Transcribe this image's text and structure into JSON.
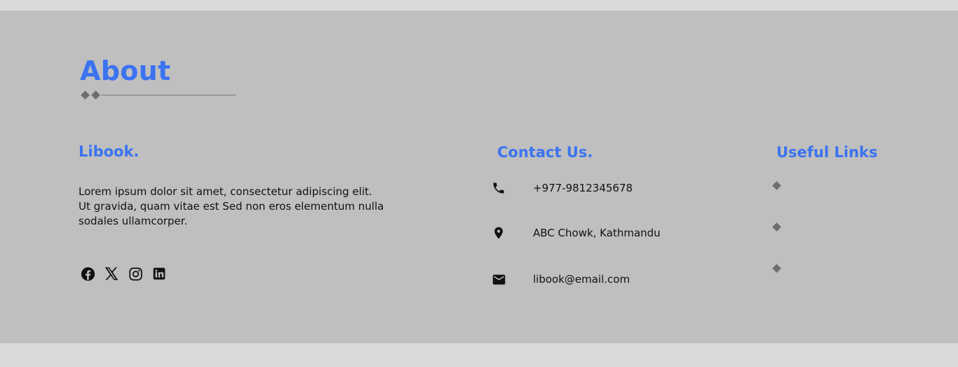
{
  "about": {
    "title": "About"
  },
  "brand": {
    "name": "Libook.",
    "description": "Lorem ipsum dolor sit amet, consectetur adipiscing elit. Ut gravida, quam vitae est Sed non eros elementum nulla sodales ullamcorper."
  },
  "socials": [
    {
      "icon": "facebook-icon"
    },
    {
      "icon": "x-icon"
    },
    {
      "icon": "instagram-icon"
    },
    {
      "icon": "linkedin-icon"
    }
  ],
  "contact": {
    "title": "Contact Us.",
    "phone": "+977-9812345678",
    "address": "ABC Chowk, Kathmandu",
    "email": "libook@email.com"
  },
  "links": {
    "title": "Useful Links"
  },
  "colors": {
    "accent": "#3b73f0",
    "panel": "#bfbfbf",
    "page": "#d9d9d9"
  }
}
